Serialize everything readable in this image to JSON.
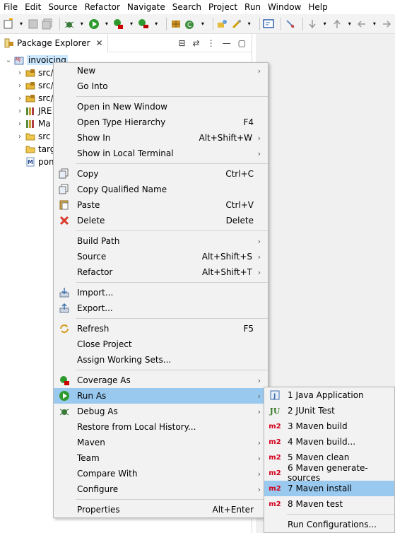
{
  "menubar": [
    "File",
    "Edit",
    "Source",
    "Refactor",
    "Navigate",
    "Search",
    "Project",
    "Run",
    "Window",
    "Help"
  ],
  "panel": {
    "tab_label": "Package Explorer",
    "tree": [
      {
        "label": "invoicing",
        "depth": 0,
        "expanded": true,
        "selected": true,
        "icon": "maven-project-icon"
      },
      {
        "label": "src/",
        "depth": 1,
        "icon": "source-folder-icon"
      },
      {
        "label": "src/",
        "depth": 1,
        "icon": "source-folder-icon"
      },
      {
        "label": "src/",
        "depth": 1,
        "icon": "source-folder-icon"
      },
      {
        "label": "JRE",
        "depth": 1,
        "icon": "library-icon"
      },
      {
        "label": "Ma",
        "depth": 1,
        "icon": "library-icon"
      },
      {
        "label": "src",
        "depth": 1,
        "icon": "folder-icon"
      },
      {
        "label": "targ",
        "depth": 1,
        "icon": "folder-icon"
      },
      {
        "label": "pom",
        "depth": 1,
        "icon": "pom-file-icon"
      }
    ]
  },
  "context_menu": {
    "groups": [
      [
        {
          "label": "New",
          "shortcut": "",
          "submenu": true,
          "icon": ""
        },
        {
          "label": "Go Into",
          "shortcut": "",
          "submenu": false,
          "icon": ""
        }
      ],
      [
        {
          "label": "Open in New Window",
          "shortcut": "",
          "submenu": false,
          "icon": ""
        },
        {
          "label": "Open Type Hierarchy",
          "shortcut": "F4",
          "submenu": false,
          "icon": ""
        },
        {
          "label": "Show In",
          "shortcut": "Alt+Shift+W",
          "submenu": true,
          "icon": ""
        },
        {
          "label": "Show in Local Terminal",
          "shortcut": "",
          "submenu": true,
          "icon": ""
        }
      ],
      [
        {
          "label": "Copy",
          "shortcut": "Ctrl+C",
          "submenu": false,
          "icon": "copy-icon"
        },
        {
          "label": "Copy Qualified Name",
          "shortcut": "",
          "submenu": false,
          "icon": "copy-qualified-icon"
        },
        {
          "label": "Paste",
          "shortcut": "Ctrl+V",
          "submenu": false,
          "icon": "paste-icon"
        },
        {
          "label": "Delete",
          "shortcut": "Delete",
          "submenu": false,
          "icon": "delete-icon"
        }
      ],
      [
        {
          "label": "Build Path",
          "shortcut": "",
          "submenu": true,
          "icon": ""
        },
        {
          "label": "Source",
          "shortcut": "Alt+Shift+S",
          "submenu": true,
          "icon": ""
        },
        {
          "label": "Refactor",
          "shortcut": "Alt+Shift+T",
          "submenu": true,
          "icon": ""
        }
      ],
      [
        {
          "label": "Import...",
          "shortcut": "",
          "submenu": false,
          "icon": "import-icon"
        },
        {
          "label": "Export...",
          "shortcut": "",
          "submenu": false,
          "icon": "export-icon"
        }
      ],
      [
        {
          "label": "Refresh",
          "shortcut": "F5",
          "submenu": false,
          "icon": "refresh-icon"
        },
        {
          "label": "Close Project",
          "shortcut": "",
          "submenu": false,
          "icon": ""
        },
        {
          "label": "Assign Working Sets...",
          "shortcut": "",
          "submenu": false,
          "icon": ""
        }
      ],
      [
        {
          "label": "Coverage As",
          "shortcut": "",
          "submenu": true,
          "icon": "coverage-icon"
        },
        {
          "label": "Run As",
          "shortcut": "",
          "submenu": true,
          "icon": "run-icon",
          "highlighted": true
        },
        {
          "label": "Debug As",
          "shortcut": "",
          "submenu": true,
          "icon": "debug-icon"
        },
        {
          "label": "Restore from Local History...",
          "shortcut": "",
          "submenu": false,
          "icon": ""
        },
        {
          "label": "Maven",
          "shortcut": "",
          "submenu": true,
          "icon": ""
        },
        {
          "label": "Team",
          "shortcut": "",
          "submenu": true,
          "icon": ""
        },
        {
          "label": "Compare With",
          "shortcut": "",
          "submenu": true,
          "icon": ""
        },
        {
          "label": "Configure",
          "shortcut": "",
          "submenu": true,
          "icon": ""
        }
      ],
      [
        {
          "label": "Properties",
          "shortcut": "Alt+Enter",
          "submenu": false,
          "icon": ""
        }
      ]
    ]
  },
  "run_as_menu": {
    "groups": [
      [
        {
          "label": "1 Java Application",
          "icon": "java-app-icon"
        },
        {
          "label": "2 JUnit Test",
          "icon": "junit-icon",
          "badge": "JU"
        },
        {
          "label": "3 Maven build",
          "icon": "m2-icon",
          "badge": "m2"
        },
        {
          "label": "4 Maven build...",
          "icon": "m2-icon",
          "badge": "m2"
        },
        {
          "label": "5 Maven clean",
          "icon": "m2-icon",
          "badge": "m2"
        },
        {
          "label": "6 Maven generate-sources",
          "icon": "m2-icon",
          "badge": "m2"
        },
        {
          "label": "7 Maven install",
          "icon": "m2-icon",
          "badge": "m2",
          "highlighted": true
        },
        {
          "label": "8 Maven test",
          "icon": "m2-icon",
          "badge": "m2"
        }
      ],
      [
        {
          "label": "Run Configurations...",
          "icon": ""
        }
      ]
    ]
  },
  "colors": {
    "highlight": "#99c9ef",
    "menu_bg": "#f2f2f2",
    "m2_red": "#d4001c",
    "selection": "#cce8ff"
  }
}
